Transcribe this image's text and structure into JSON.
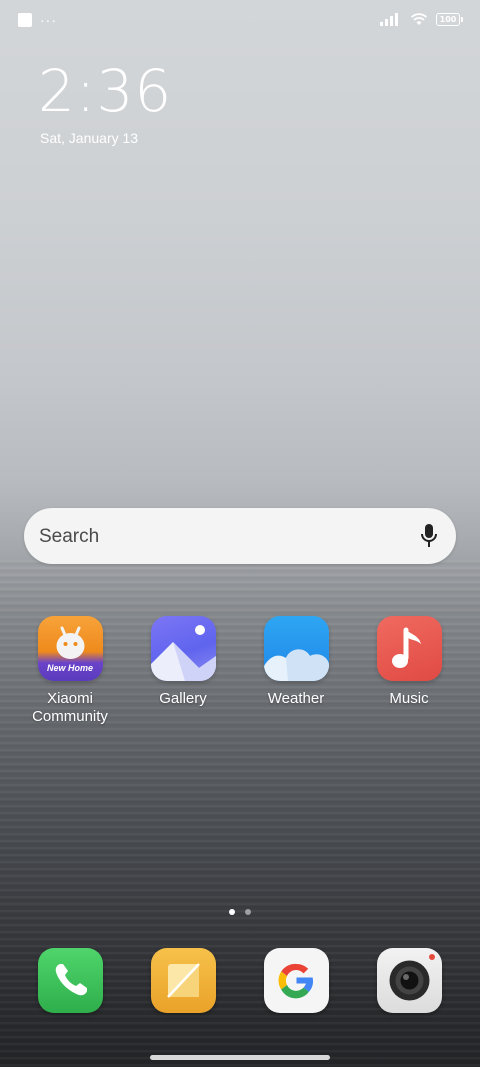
{
  "status_bar": {
    "battery_level": "100",
    "overflow_indicator": "···",
    "icons": [
      "notification-square-icon",
      "signal-icon",
      "wifi-icon",
      "battery-icon"
    ]
  },
  "lock_clock": {
    "time": "2:36",
    "date": "Sat, January 13"
  },
  "search_bar": {
    "placeholder": "Search",
    "icon": "mic-icon"
  },
  "apps": [
    {
      "label_line1": "Xiaomi",
      "label_line2": "Community",
      "icon": "xiaomi-community-icon",
      "badge_text": "New Home"
    },
    {
      "label": "Gallery",
      "icon": "gallery-icon"
    },
    {
      "label": "Weather",
      "icon": "weather-icon"
    },
    {
      "label": "Music",
      "icon": "music-icon"
    }
  ],
  "page_indicator": {
    "pages": 2,
    "active": 1
  },
  "dock": [
    {
      "name": "Phone",
      "icon": "phone-icon"
    },
    {
      "name": "Notes",
      "icon": "notes-icon"
    },
    {
      "name": "Google",
      "icon": "google-icon"
    },
    {
      "name": "Camera",
      "icon": "camera-icon"
    }
  ],
  "colors": {
    "phone_green": "#3ec45a",
    "notes_yellow": "#f2b53a",
    "music_red": "#e8504a",
    "weather_blue": "#2f9ff0",
    "gallery_purple": "#6b6cf0",
    "community_orange": "#f08a1e"
  }
}
